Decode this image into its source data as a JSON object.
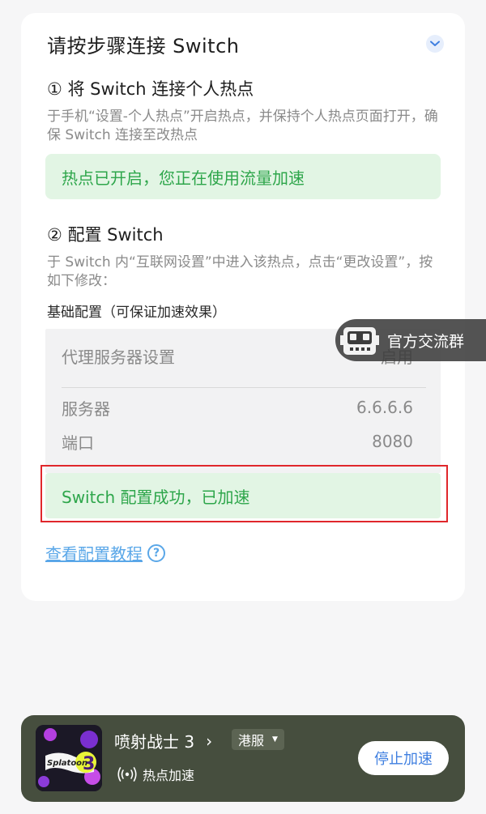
{
  "card": {
    "title": "请按步骤连接 Switch",
    "step1": {
      "title": "① 将 Switch 连接个人热点",
      "desc": "于手机“设置-个人热点”开启热点，并保持个人热点页面打开，确保 Switch 连接至改热点",
      "status": "热点已开启，您正在使用流量加速"
    },
    "step2": {
      "title": "② 配置 Switch",
      "desc": "于 Switch 内“互联网设置”中进入该热点，点击“更改设置”，按如下修改：",
      "sub_label": "基础配置（可保证加速效果）",
      "config": {
        "proxy_label": "代理服务器设置",
        "proxy_value": "启用",
        "server_label": "服务器",
        "server_value": "6.6.6.6",
        "port_label": "端口",
        "port_value": "8080"
      },
      "success": "Switch 配置成功，已加速"
    },
    "tutorial_link": "查看配置教程",
    "help_symbol": "?"
  },
  "community": {
    "label": "官方交流群",
    "icon": "robot-icon"
  },
  "bottom_bar": {
    "game_name": "喷射战士 3",
    "chevron": "›",
    "region": "港服",
    "mode": "热点加速",
    "stop_button": "停止加速",
    "game_icon_text": "Splatoon 3",
    "colors": {
      "bar": "#464e3e",
      "accent": "#3f7fe0",
      "success": "#2ea64b",
      "link": "#5aa7e8",
      "highlight": "#e0272b"
    }
  }
}
